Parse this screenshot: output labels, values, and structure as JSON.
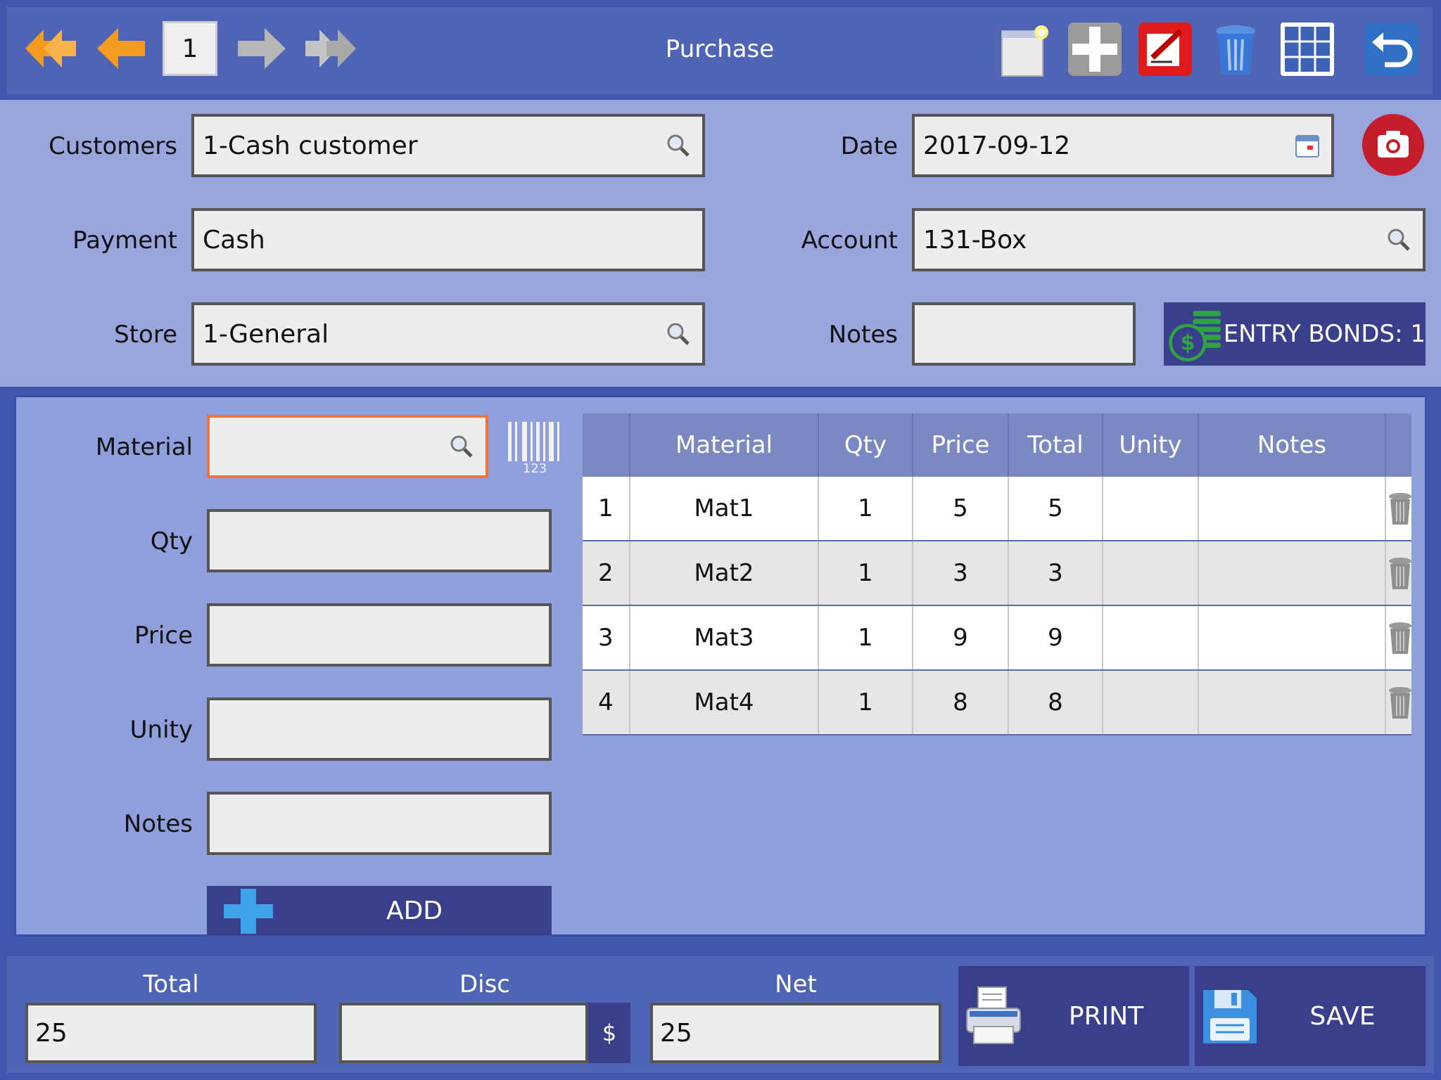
{
  "toolbar": {
    "page_number": "1",
    "title": "Purchase"
  },
  "form": {
    "customers": {
      "label": "Customers",
      "value": "1-Cash customer"
    },
    "date": {
      "label": "Date",
      "value": "2017-09-12"
    },
    "payment": {
      "label": "Payment",
      "value": "Cash"
    },
    "account": {
      "label": "Account",
      "value": "131-Box"
    },
    "store": {
      "label": "Store",
      "value": "1-General"
    },
    "notes": {
      "label": "Notes",
      "value": ""
    },
    "entry_bonds": "ENTRY BONDS: 1"
  },
  "material_panel": {
    "material_label": "Material",
    "qty_label": "Qty",
    "price_label": "Price",
    "unity_label": "Unity",
    "notes_label": "Notes",
    "barcode_digits": "123",
    "add_label": "ADD"
  },
  "table": {
    "columns": [
      "",
      "Material",
      "Qty",
      "Price",
      "Total",
      "Unity",
      "Notes"
    ],
    "rows": [
      {
        "n": "1",
        "material": "Mat1",
        "qty": "1",
        "price": "5",
        "total": "5",
        "unity": "",
        "notes": ""
      },
      {
        "n": "2",
        "material": "Mat2",
        "qty": "1",
        "price": "3",
        "total": "3",
        "unity": "",
        "notes": ""
      },
      {
        "n": "3",
        "material": "Mat3",
        "qty": "1",
        "price": "9",
        "total": "9",
        "unity": "",
        "notes": ""
      },
      {
        "n": "4",
        "material": "Mat4",
        "qty": "1",
        "price": "8",
        "total": "8",
        "unity": "",
        "notes": ""
      }
    ]
  },
  "bottom": {
    "total_label": "Total",
    "total_value": "25",
    "disc_label": "Disc",
    "disc_value": "",
    "currency": "$",
    "net_label": "Net",
    "net_value": "25",
    "print_label": "PRINT",
    "save_label": "SAVE"
  },
  "colors": {
    "background": "#3f57ac",
    "toolbar": "#5064b6",
    "form_bg": "#99a6dd",
    "panel_bg": "#8e9fdc",
    "button_dark": "#3a3f8c",
    "accent_orange": "#f0743a"
  }
}
